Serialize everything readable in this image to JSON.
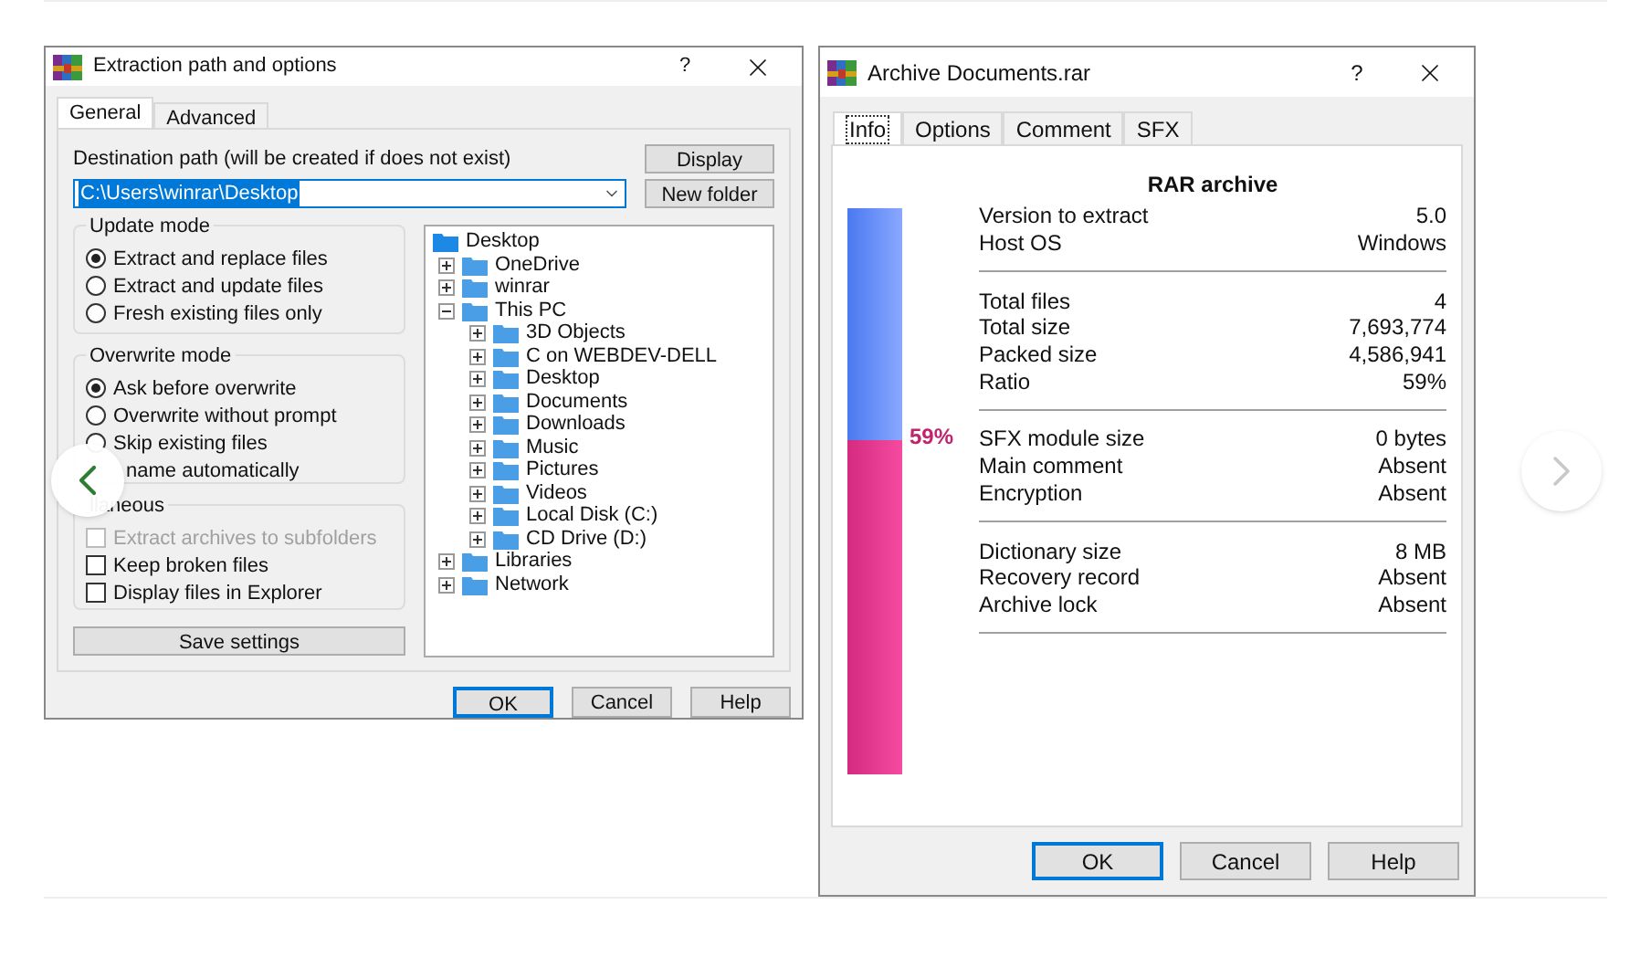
{
  "left_dialog": {
    "title": "Extraction path and options",
    "help": "?",
    "tabs": [
      {
        "label": "General",
        "selected": true
      },
      {
        "label": "Advanced",
        "selected": false
      }
    ],
    "destination_label": "Destination path (will be created if does not exist)",
    "path_value": "C:\\Users\\winrar\\Desktop",
    "side_buttons": [
      "Display",
      "New folder"
    ],
    "update_mode": {
      "title": "Update mode",
      "options": [
        {
          "label": "Extract and replace files",
          "selected": true
        },
        {
          "label": "Extract and update files",
          "selected": false
        },
        {
          "label": "Fresh existing files only",
          "selected": false
        }
      ]
    },
    "overwrite_mode": {
      "title": "Overwrite mode",
      "options": [
        {
          "label": "Ask before overwrite",
          "selected": true
        },
        {
          "label": "Overwrite without prompt",
          "selected": false
        },
        {
          "label": "Skip existing files",
          "selected": false
        },
        {
          "label": "name automatically",
          "kind": "text"
        }
      ]
    },
    "miscellaneous": {
      "title": "llaneous",
      "options": [
        {
          "label": "Extract archives to subfolders",
          "checked": false,
          "disabled": true
        },
        {
          "label": "Keep broken files",
          "checked": false,
          "disabled": false
        },
        {
          "label": "Display files in Explorer",
          "checked": false,
          "disabled": false
        }
      ]
    },
    "save_button": "Save settings",
    "tree": [
      {
        "label": "Desktop",
        "children": [
          {
            "label": "OneDrive",
            "expanded": false
          },
          {
            "label": "winrar",
            "expanded": false
          },
          {
            "label": "This PC",
            "expanded": true,
            "children": [
              {
                "label": "3D Objects",
                "expanded": false
              },
              {
                "label": "C on WEBDEV-DELL",
                "expanded": false
              },
              {
                "label": "Desktop",
                "expanded": false
              },
              {
                "label": "Documents",
                "expanded": false
              },
              {
                "label": "Downloads",
                "expanded": false
              },
              {
                "label": "Music",
                "expanded": false
              },
              {
                "label": "Pictures",
                "expanded": false
              },
              {
                "label": "Videos",
                "expanded": false
              },
              {
                "label": "Local Disk (C:)",
                "expanded": false
              },
              {
                "label": "CD Drive (D:)",
                "expanded": false
              }
            ]
          },
          {
            "label": "Libraries",
            "expanded": false
          },
          {
            "label": "Network",
            "expanded": false
          }
        ]
      }
    ],
    "footer_buttons": [
      {
        "label": "OK",
        "selected": true
      },
      {
        "label": "Cancel",
        "selected": false
      },
      {
        "label": "Help",
        "selected": false
      }
    ]
  },
  "right_dialog": {
    "title": "Archive Documents.rar",
    "help": "?",
    "tabs": [
      {
        "label": "Info",
        "selected": true
      },
      {
        "label": "Options",
        "selected": false
      },
      {
        "label": "Comment",
        "selected": false
      },
      {
        "label": "SFX",
        "selected": false
      }
    ],
    "heading": "RAR archive",
    "ratio_meter": {
      "level": 0.59,
      "label": "59%"
    },
    "sections": [
      [
        {
          "label": "Version to extract",
          "value": "5.0"
        },
        {
          "label": "Host OS",
          "value": "Windows"
        }
      ],
      [
        {
          "label": "Total files",
          "value": "4"
        },
        {
          "label": "Total size",
          "value": "7,693,774"
        },
        {
          "label": "Packed size",
          "value": "4,586,941"
        },
        {
          "label": "Ratio",
          "value": "59%"
        }
      ],
      [
        {
          "label": "SFX module size",
          "value": "0 bytes"
        },
        {
          "label": "Main comment",
          "value": "Absent"
        },
        {
          "label": "Encryption",
          "value": "Absent"
        }
      ],
      [
        {
          "label": "Dictionary size",
          "value": "8 MB"
        },
        {
          "label": "Recovery record",
          "value": "Absent"
        },
        {
          "label": "Archive lock",
          "value": "Absent"
        }
      ]
    ],
    "footer_buttons": [
      {
        "label": "OK",
        "selected": true
      },
      {
        "label": "Cancel",
        "selected": false
      },
      {
        "label": "Help",
        "selected": false
      }
    ]
  }
}
